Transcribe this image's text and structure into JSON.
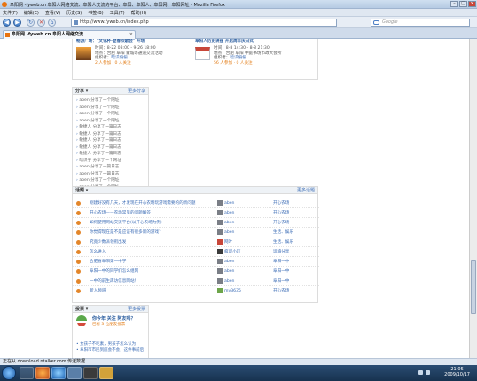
{
  "window": {
    "title": "阜阳网 -fyweb.cn 阜阳人网络交流、阜阳人交流的平台、阜阳、阜阳人、阜阳网、阜阳网址 - Mozilla Firefox"
  },
  "menubar": [
    "文件(F)",
    "编辑(E)",
    "查看(V)",
    "历史(S)",
    "书签(B)",
    "工具(T)",
    "帮助(H)"
  ],
  "navbar": {
    "back": "◀",
    "forward": "▶",
    "url": "http://www.fyweb.cn/index.php",
    "search_placeholder": "Google"
  },
  "tab": {
    "label": "阜阳网 -fyweb.cn 阜阳人网络交流..."
  },
  "events": [
    {
      "title": "畅游广场：\"文化杯·登春吹歌会\" 开场",
      "time": "8-22 08:00 - 9-26 18:00",
      "place": "合肥 阜阳 蒙城等通道交流活动",
      "sponsor": "组织者：",
      "sponsor_name": "暗识偏偏",
      "stats": "2 人参加 · 0 人关注"
    },
    {
      "title": "阜阳人历史讲座 开启周年庆日式",
      "time": "8-8 14:30 - 8-8 21:30",
      "place": "合肥 阜阳 中庭书坊市政大会所",
      "sponsor": "组织者：",
      "sponsor_name": "暗识偏偏",
      "stats": "56 人参加 · 0 人关注"
    }
  ],
  "event_labels": {
    "time": "时间：",
    "place": "地点："
  },
  "share": {
    "heading": "分享 ▾",
    "more": "更多分享",
    "items": [
      {
        "user": "aben",
        "text": " 分享了一个网址"
      },
      {
        "user": "aben",
        "text": " 分享了一个网址"
      },
      {
        "user": "aben",
        "text": " 分享了一个网址"
      },
      {
        "user": "aben",
        "text": " 分享了一个网址"
      },
      {
        "user": "敏捷人",
        "text": " 分享了一篇日志"
      },
      {
        "user": "敏捷人",
        "text": " 分享了一篇日志"
      },
      {
        "user": "敏捷人",
        "text": " 分享了一篇日志"
      },
      {
        "user": "敏捷人",
        "text": " 分享了一篇日志"
      },
      {
        "user": "敏捷人",
        "text": " 分享了一篇日志"
      },
      {
        "user": "暗识子",
        "text": " 分享了一个网址"
      },
      {
        "user": "aben",
        "text": " 分享了一篇日志"
      },
      {
        "user": "aben",
        "text": " 分享了一篇日志"
      },
      {
        "user": "aben",
        "text": " 分享了一个网址"
      },
      {
        "user": "aben",
        "text": " 分享了一个网址"
      }
    ]
  },
  "topics": {
    "heading": "话题 ▾",
    "more": "更多话题",
    "rows": [
      {
        "title": "刚建好没有几天，才发现在开心农场玩游戏需要的的新问题",
        "author": "aben",
        "group": "开心农场"
      },
      {
        "title": "开心农场——农场常见的问题解答",
        "author": "aben",
        "group": "开心农场"
      },
      {
        "title": "如何使用网站交流平台(以开心农场为例)",
        "author": "aben",
        "group": "开心农场"
      },
      {
        "title": "你觉得现在是不是应该有很多新的游戏？",
        "author": "aben",
        "group": "生活、娱乐"
      },
      {
        "title": "究竟少数派领衔出发",
        "author": "网叶",
        "group": "生活、娱乐"
      },
      {
        "title": "怎么进入",
        "author": "疯说小叮",
        "group": "运输分享"
      },
      {
        "title": "合肥省阜阳第一中学",
        "author": "aben",
        "group": "阜阳一中"
      },
      {
        "title": "阜阳一中的同学们怎么组网",
        "author": "aben",
        "group": "阜阳一中"
      },
      {
        "title": "一中的前生再访信息网站！",
        "author": "aben",
        "group": "阜阳一中"
      },
      {
        "title": "新入频道",
        "author": "my3635",
        "group": "开心农场"
      }
    ]
  },
  "vote": {
    "heading": "投票 ▾",
    "more": "更多投票",
    "question": "你今年 关注 阿友吗？",
    "meta": "已有 3 位朋友投票",
    "items": [
      "• 女孩子不吃素，男孩子怎么认为",
      "• 阜阳市市民到底会不会，这件事前后"
    ]
  },
  "status": {
    "text": "正在从 download.ntalker.com 传送数据..."
  },
  "clock": {
    "time": "21:05",
    "date": "2009/10/17"
  }
}
